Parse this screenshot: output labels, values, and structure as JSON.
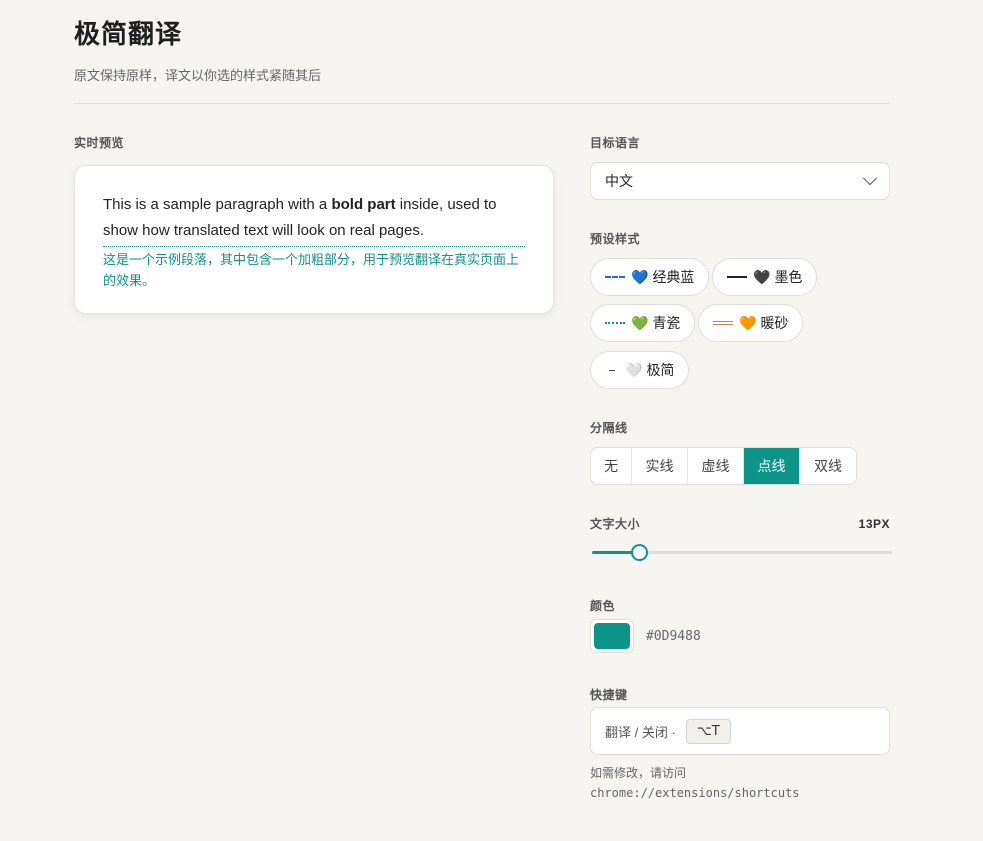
{
  "header": {
    "title": "极简翻译",
    "subtitle": "原文保持原样，译文以你选的样式紧随其后"
  },
  "preview": {
    "label": "实时预览",
    "en_before": "This is a sample paragraph with a ",
    "en_bold": "bold part",
    "en_after": " inside, used to show how translated text will look on real pages.",
    "zh": "这是一个示例段落，其中包含一个加粗部分，用于预览翻译在真实页面上的效果。"
  },
  "target_language": {
    "label": "目标语言",
    "value": "中文"
  },
  "presets": {
    "label": "预设样式",
    "items": [
      {
        "label": "经典蓝",
        "heart": "💙",
        "line_style": "dashed",
        "line_color": "#2563EB"
      },
      {
        "label": "墨色",
        "heart": "🖤",
        "line_style": "solid",
        "line_color": "#222222"
      },
      {
        "label": "青瓷",
        "heart": "💚",
        "line_style": "dotted",
        "line_color": "#0D9488"
      },
      {
        "label": "暖砂",
        "heart": "🧡",
        "line_style": "double",
        "line_color": "#C2814A"
      },
      {
        "label": "极简",
        "heart": "🤍",
        "line_style": "short",
        "line_color": "#444444"
      }
    ]
  },
  "divider": {
    "label": "分隔线",
    "options": [
      "无",
      "实线",
      "虚线",
      "点线",
      "双线"
    ],
    "selected": "点线"
  },
  "font_size": {
    "label": "文字大小",
    "value_text": "13PX",
    "fraction": 0.155
  },
  "color": {
    "label": "颜色",
    "hex": "#0D9488"
  },
  "shortcut": {
    "label": "快捷键",
    "text": "翻译 / 关闭 ·",
    "key": "⌥T",
    "hint": "如需修改，请访问",
    "hint_url": "chrome://extensions/shortcuts"
  }
}
